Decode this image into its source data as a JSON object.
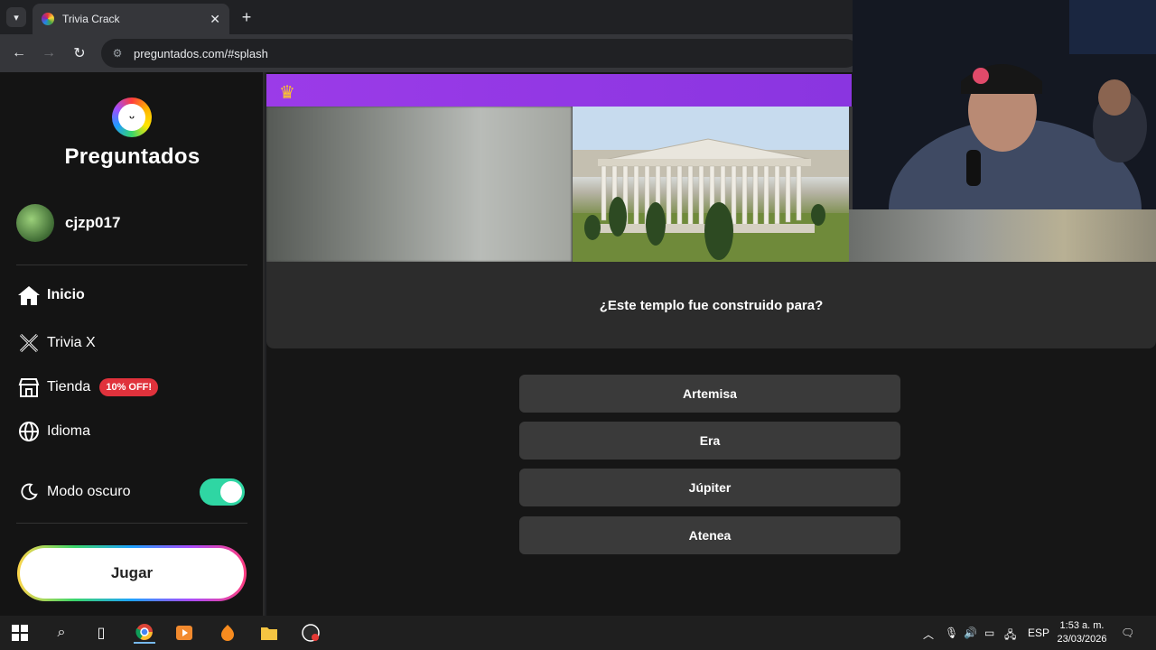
{
  "browser": {
    "tab_title": "Trivia Crack",
    "url": "preguntados.com/#splash"
  },
  "sidebar": {
    "logo_text": "Preguntados",
    "username": "cjzp017",
    "items": [
      {
        "label": "Inicio",
        "icon": "home-icon"
      },
      {
        "label": "Trivia X",
        "icon": "trivia-x-icon"
      },
      {
        "label": "Tienda",
        "icon": "store-icon",
        "badge": "10% OFF!"
      },
      {
        "label": "Idioma",
        "icon": "globe-icon"
      }
    ],
    "dark_mode_label": "Modo oscuro",
    "dark_mode_on": true,
    "play_label": "Jugar"
  },
  "game": {
    "question": "¿Este templo fue construido para?",
    "answers": [
      "Artemisa",
      "Era",
      "Júpiter",
      "Atenea"
    ]
  },
  "taskbar": {
    "language": "ESP",
    "time": "1:53 a. m.",
    "date": "23/03/2026"
  },
  "colors": {
    "accent_purple": "#9b3be8",
    "toggle_green": "#2fd6a3",
    "badge_red": "#e0323c"
  }
}
